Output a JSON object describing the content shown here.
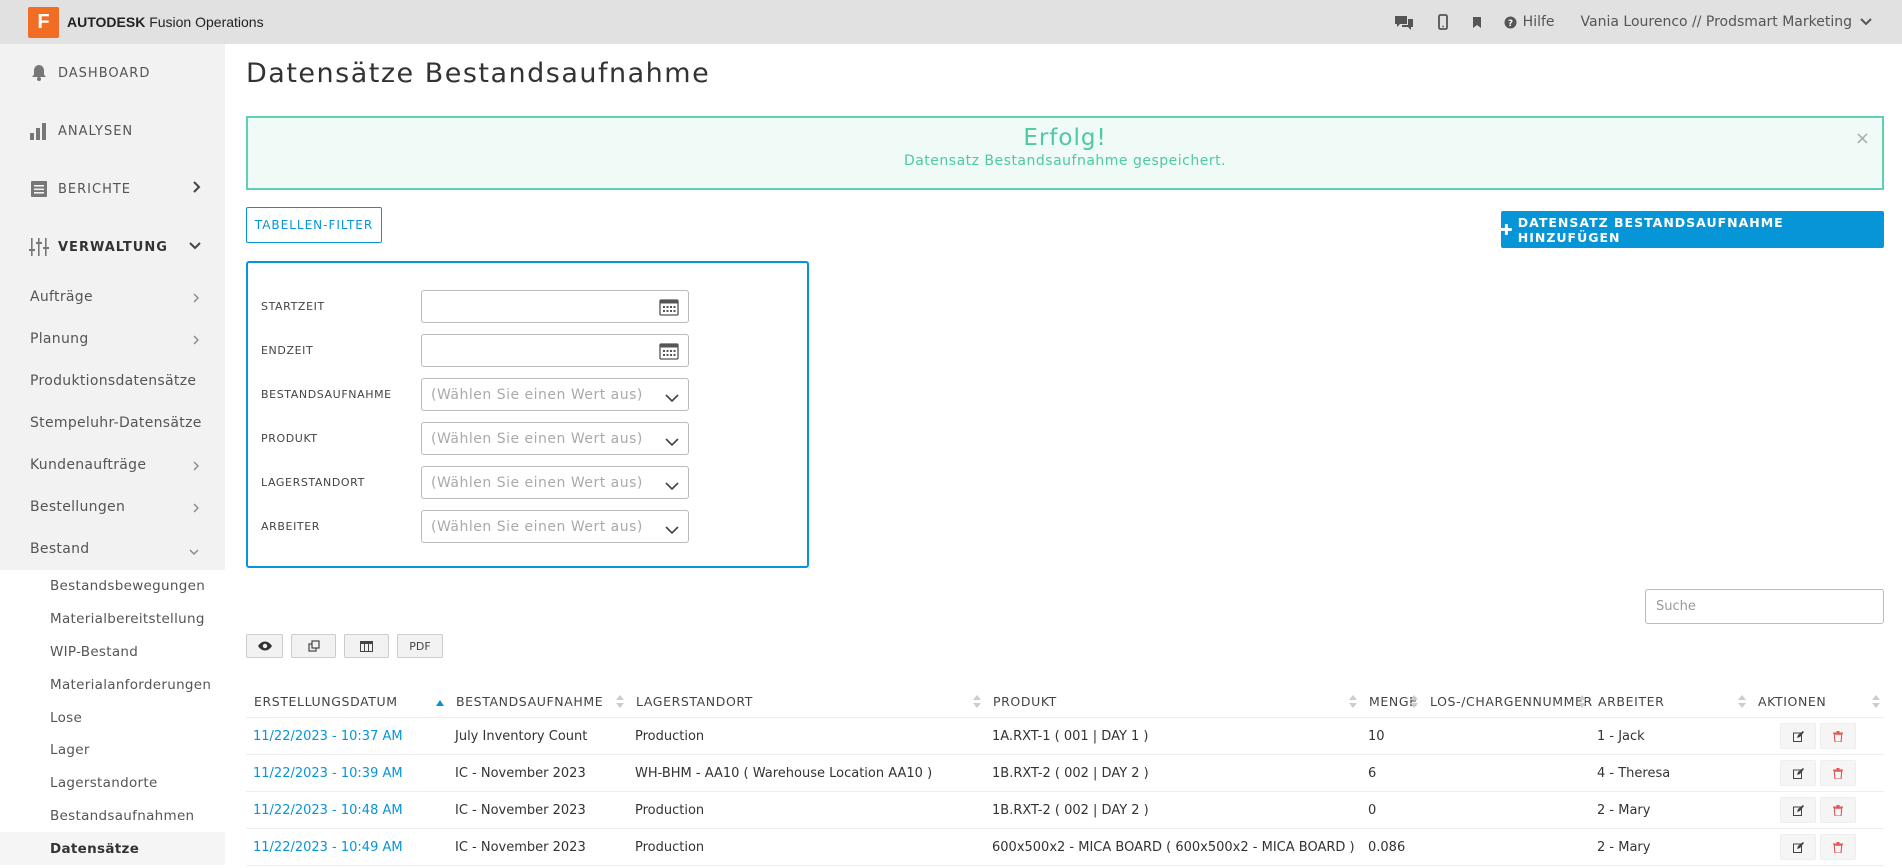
{
  "app": {
    "brand_bold": "AUTODESK",
    "brand_rest": " Fusion Operations",
    "logo_letter": "F",
    "help_label": "Hilfe",
    "user_label": "Vania Lourenco // Prodsmart Marketing"
  },
  "sidebar": {
    "main": [
      {
        "label": "DASHBOARD",
        "icon": "bell-icon"
      },
      {
        "label": "ANALYSEN",
        "icon": "bar-chart-icon"
      },
      {
        "label": "BERICHTE",
        "icon": "report-icon"
      },
      {
        "label": "VERWALTUNG",
        "icon": "sliders-icon"
      }
    ],
    "sub": [
      "Aufträge",
      "Planung",
      "Produktionsdatensätze",
      "Stempeluhr-Datensätze",
      "Kundenaufträge",
      "Bestellungen",
      "Bestand"
    ],
    "bestand_items": [
      "Bestandsbewegungen",
      "Materialbereitstellung",
      "WIP-Bestand",
      "Materialanforderungen",
      "Lose",
      "Lager",
      "Lagerstandorte",
      "Bestandsaufnahmen",
      "Datensätze"
    ]
  },
  "page": {
    "title": "Datensätze Bestandsaufnahme",
    "alert_title": "Erfolg!",
    "alert_message": "Datensatz Bestandsaufnahme gespeichert.",
    "alert_close": "×",
    "filter_button": "TABELLEN-FILTER",
    "add_button": "DATENSATZ BESTANDSAUFNAHME HINZUFÜGEN",
    "search_placeholder": "Suche",
    "pdf_label": "PDF"
  },
  "filters": {
    "startzeit": "STARTZEIT",
    "endzeit": "ENDZEIT",
    "bestandsaufnahme": "BESTANDSAUFNAHME",
    "produkt": "PRODUKT",
    "lagerstandort": "LAGERSTANDORT",
    "arbeiter": "ARBEITER",
    "select_placeholder": "(Wählen Sie einen Wert aus)"
  },
  "table": {
    "headers": [
      "ERSTELLUNGSDATUM",
      "BESTANDSAUFNAHME",
      "LAGERSTANDORT",
      "PRODUKT",
      "MENGE",
      "LOS-/CHARGENNUMMER",
      "ARBEITER",
      "AKTIONEN"
    ],
    "rows": [
      [
        "11/22/2023 - 10:37 AM",
        "July Inventory Count",
        "Production",
        "1A.RXT-1 ( 001 | DAY 1 )",
        "10",
        "",
        "1 - Jack"
      ],
      [
        "11/22/2023 - 10:39 AM",
        "IC - November 2023",
        "WH-BHM - AA10 ( Warehouse Location AA10 )",
        "1B.RXT-2 ( 002 | DAY 2 )",
        "6",
        "",
        "4 - Theresa"
      ],
      [
        "11/22/2023 - 10:48 AM",
        "IC - November 2023",
        "Production",
        "1B.RXT-2 ( 002 | DAY 2 )",
        "0",
        "",
        "2 - Mary"
      ],
      [
        "11/22/2023 - 10:49 AM",
        "IC - November 2023",
        "Production",
        "600x500x2 - MICA BOARD ( 600x500x2 - MICA BOARD )",
        "0.086",
        "",
        "2 - Mary"
      ]
    ]
  },
  "colors": {
    "accent": "#0696d7",
    "success": "#4dc9a4",
    "delete": "#e05555",
    "logo": "#f26d24"
  }
}
